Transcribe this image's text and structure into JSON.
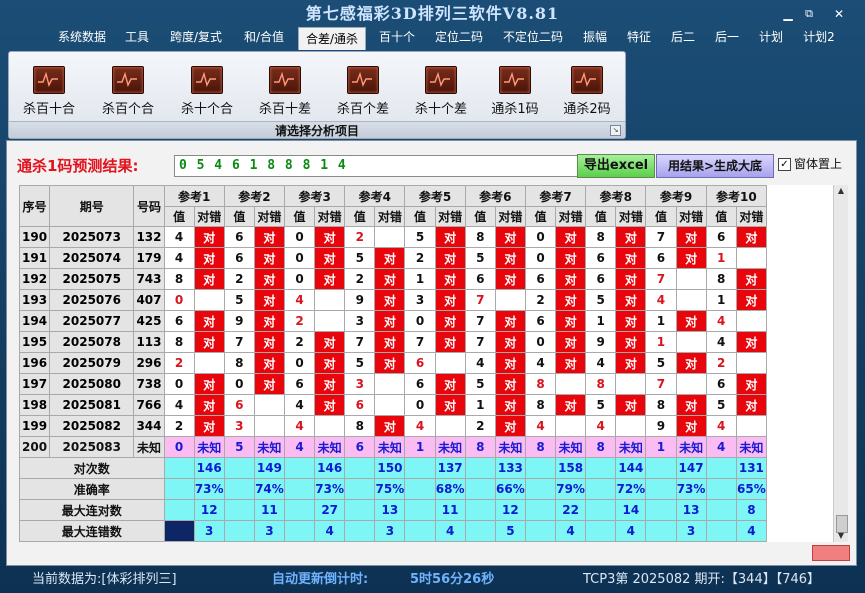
{
  "window": {
    "title": "第七感福彩3D排列三软件V8.81",
    "minimize": "▁",
    "restore": "⧉",
    "close": "✕"
  },
  "menu": [
    "系统数据",
    "工具",
    "跨度/复式",
    "和/合值",
    "合差/通杀",
    "百十个",
    "定位二码",
    "不定位二码",
    "振幅",
    "特征",
    "后二",
    "后一",
    "计划",
    "计划2"
  ],
  "ribbon": {
    "buttons": [
      "杀百十合",
      "杀百个合",
      "杀十个合",
      "杀百十差",
      "杀百个差",
      "杀十个差",
      "通杀1码",
      "通杀2码"
    ],
    "group_label": "请选择分析项目",
    "icon": "chart-line-icon"
  },
  "prediction": {
    "label": "通杀1码预测结果:",
    "value": "0 5 4 6 1 8 8 8 1 4",
    "excel_button": "导出excel",
    "generate_button": "用结果>生成大底",
    "topmost_label": "窗体置上",
    "topmost_checked": "✓"
  },
  "grid": {
    "col_seq": "序号",
    "col_period": "期号",
    "col_number": "号码",
    "ref_headers": [
      "参考1",
      "参考2",
      "参考3",
      "参考4",
      "参考5",
      "参考6",
      "参考7",
      "参考8",
      "参考9",
      "参考10"
    ],
    "sub_value": "值",
    "sub_result": "对错",
    "hit_mark": "对",
    "rows": [
      {
        "seq": "190",
        "period": "2025073",
        "num": "132",
        "refs": [
          [
            "4",
            1
          ],
          [
            "6",
            1
          ],
          [
            "0",
            1
          ],
          [
            "2",
            0
          ],
          [
            "5",
            1
          ],
          [
            "8",
            1
          ],
          [
            "0",
            1
          ],
          [
            "8",
            1
          ],
          [
            "7",
            1
          ],
          [
            "6",
            1
          ]
        ]
      },
      {
        "seq": "191",
        "period": "2025074",
        "num": "179",
        "refs": [
          [
            "4",
            1
          ],
          [
            "6",
            1
          ],
          [
            "0",
            1
          ],
          [
            "5",
            1
          ],
          [
            "2",
            1
          ],
          [
            "5",
            1
          ],
          [
            "0",
            1
          ],
          [
            "6",
            1
          ],
          [
            "6",
            1
          ],
          [
            "1",
            0
          ]
        ]
      },
      {
        "seq": "192",
        "period": "2025075",
        "num": "743",
        "refs": [
          [
            "8",
            1
          ],
          [
            "2",
            1
          ],
          [
            "0",
            1
          ],
          [
            "2",
            1
          ],
          [
            "1",
            1
          ],
          [
            "6",
            1
          ],
          [
            "6",
            1
          ],
          [
            "6",
            1
          ],
          [
            "7",
            0
          ],
          [
            "8",
            1
          ]
        ]
      },
      {
        "seq": "193",
        "period": "2025076",
        "num": "407",
        "refs": [
          [
            "0",
            0
          ],
          [
            "5",
            1
          ],
          [
            "4",
            0
          ],
          [
            "9",
            1
          ],
          [
            "3",
            1
          ],
          [
            "7",
            0
          ],
          [
            "2",
            1
          ],
          [
            "5",
            1
          ],
          [
            "4",
            0
          ],
          [
            "1",
            1
          ]
        ]
      },
      {
        "seq": "194",
        "period": "2025077",
        "num": "425",
        "refs": [
          [
            "6",
            1
          ],
          [
            "9",
            1
          ],
          [
            "2",
            0
          ],
          [
            "3",
            1
          ],
          [
            "0",
            1
          ],
          [
            "7",
            1
          ],
          [
            "6",
            1
          ],
          [
            "1",
            1
          ],
          [
            "1",
            1
          ],
          [
            "4",
            0
          ]
        ]
      },
      {
        "seq": "195",
        "period": "2025078",
        "num": "113",
        "refs": [
          [
            "8",
            1
          ],
          [
            "7",
            1
          ],
          [
            "2",
            1
          ],
          [
            "7",
            1
          ],
          [
            "7",
            1
          ],
          [
            "7",
            1
          ],
          [
            "0",
            1
          ],
          [
            "9",
            1
          ],
          [
            "1",
            0
          ],
          [
            "4",
            1
          ]
        ]
      },
      {
        "seq": "196",
        "period": "2025079",
        "num": "296",
        "refs": [
          [
            "2",
            0
          ],
          [
            "8",
            1
          ],
          [
            "0",
            1
          ],
          [
            "5",
            1
          ],
          [
            "6",
            0
          ],
          [
            "4",
            1
          ],
          [
            "4",
            1
          ],
          [
            "4",
            1
          ],
          [
            "5",
            1
          ],
          [
            "2",
            0
          ]
        ]
      },
      {
        "seq": "197",
        "period": "2025080",
        "num": "738",
        "refs": [
          [
            "0",
            1
          ],
          [
            "0",
            1
          ],
          [
            "6",
            1
          ],
          [
            "3",
            0
          ],
          [
            "6",
            1
          ],
          [
            "5",
            1
          ],
          [
            "8",
            0
          ],
          [
            "8",
            0
          ],
          [
            "7",
            0
          ],
          [
            "6",
            1
          ]
        ]
      },
      {
        "seq": "198",
        "period": "2025081",
        "num": "766",
        "refs": [
          [
            "4",
            1
          ],
          [
            "6",
            0
          ],
          [
            "4",
            1
          ],
          [
            "6",
            0
          ],
          [
            "0",
            1
          ],
          [
            "1",
            1
          ],
          [
            "8",
            1
          ],
          [
            "5",
            1
          ],
          [
            "8",
            1
          ],
          [
            "5",
            1
          ]
        ]
      },
      {
        "seq": "199",
        "period": "2025082",
        "num": "344",
        "refs": [
          [
            "2",
            1
          ],
          [
            "3",
            0
          ],
          [
            "4",
            0
          ],
          [
            "8",
            1
          ],
          [
            "4",
            0
          ],
          [
            "2",
            1
          ],
          [
            "4",
            0
          ],
          [
            "4",
            0
          ],
          [
            "9",
            1
          ],
          [
            "4",
            0
          ]
        ]
      }
    ],
    "pending": {
      "seq": "200",
      "period": "2025083",
      "num": "未知",
      "values": [
        "0",
        "5",
        "4",
        "6",
        "1",
        "8",
        "8",
        "8",
        "1",
        "4"
      ],
      "result": "未知"
    },
    "stats": [
      {
        "label": "对次数",
        "values": [
          "146",
          "149",
          "146",
          "150",
          "137",
          "133",
          "158",
          "144",
          "147",
          "131"
        ]
      },
      {
        "label": "准确率",
        "values": [
          "73%",
          "74%",
          "73%",
          "75%",
          "68%",
          "66%",
          "79%",
          "72%",
          "73%",
          "65%"
        ]
      },
      {
        "label": "最大连对数",
        "values": [
          "12",
          "11",
          "27",
          "13",
          "11",
          "12",
          "22",
          "14",
          "13",
          "8"
        ]
      },
      {
        "label": "最大连错数",
        "values": [
          "3",
          "3",
          "4",
          "3",
          "4",
          "5",
          "4",
          "4",
          "3",
          "4"
        ]
      }
    ]
  },
  "status": {
    "current_data": "当前数据为:[体彩排列三]",
    "countdown_label": "自动更新倒计时:",
    "countdown_value": "5时56分26秒",
    "draw_info": "TCP3第 2025082 期开:【344】【746】"
  },
  "colors": {
    "hit": "#e8060c",
    "miss": "#ffffff",
    "pending": "#fbbbf3",
    "stats": "#7ff6f6",
    "miss_value": "#d8141e"
  }
}
